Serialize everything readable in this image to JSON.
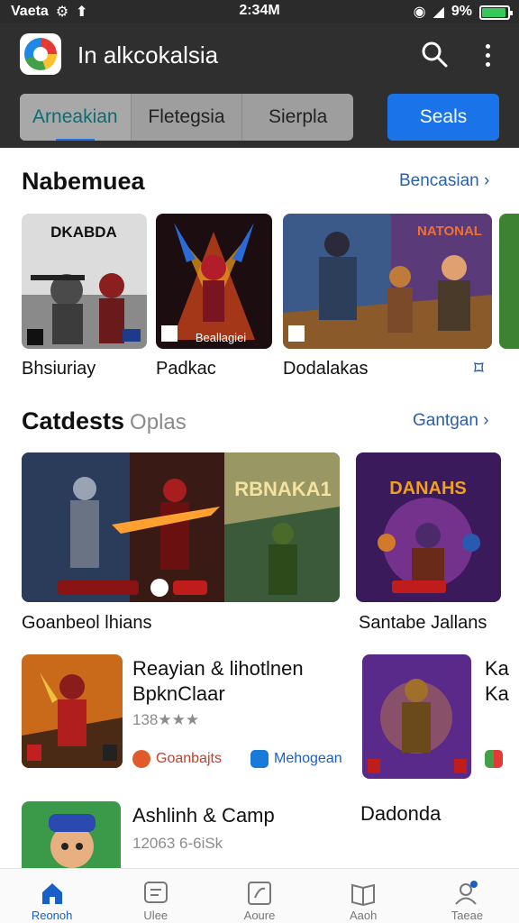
{
  "status": {
    "carrier": "Vaeta",
    "time": "2:34M",
    "battery": "9%"
  },
  "app": {
    "title": "In alkcokalsia"
  },
  "tabs": [
    {
      "label": "Arneakian"
    },
    {
      "label": "Fletegsia"
    },
    {
      "label": "Sierpla"
    }
  ],
  "tab_cta": "Seals",
  "section1": {
    "title": "Nabemuea",
    "link": "Bencasian",
    "items": [
      {
        "caption": "Bhsiuriay",
        "art_text": "DKABDA"
      },
      {
        "caption": "Padkac",
        "art_text": "Beallagiei"
      },
      {
        "caption": "Dodalakas",
        "art_text": "NATONAL"
      }
    ]
  },
  "section2": {
    "title": "Catdests",
    "subtitle": "Oplas",
    "link": "Gantgan",
    "cards": [
      {
        "caption": "Goanbeol lhians",
        "art_text": "RBNAKA1"
      },
      {
        "caption": "Santabe Jallans",
        "art_text": "DANAHS"
      }
    ]
  },
  "games": [
    {
      "title": "Reayian & lihotlnen BpknClaar",
      "rating": "138★★★",
      "chip1": "Goanbajts",
      "chip2": "Mehogean"
    },
    {
      "title": "Ashlinh & Camp",
      "rating": "12063 6-6iSk"
    }
  ],
  "side_game": {
    "title": "Dadonda",
    "edge_text": "Ka Ka"
  },
  "nav": [
    {
      "label": "Reonoh",
      "icon": "home-icon"
    },
    {
      "label": "Ulee",
      "icon": "apps-icon"
    },
    {
      "label": "Aoure",
      "icon": "games-icon"
    },
    {
      "label": "Aaoh",
      "icon": "book-icon"
    },
    {
      "label": "Taeae",
      "icon": "account-icon"
    }
  ],
  "colors": {
    "accent": "#1a73e8",
    "appbar": "#2f2f2f",
    "link": "#2b5fa8"
  }
}
